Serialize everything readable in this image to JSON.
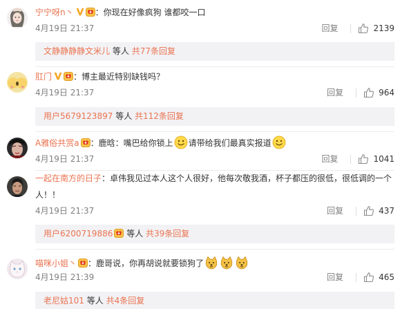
{
  "comments": [
    {
      "username": "宁宁呀n丶",
      "separator": "：",
      "text": "你现在好像疯狗 谁都咬一口",
      "time": "4月19日 21:37",
      "reply_label": "回复",
      "likes": "2139",
      "sub": {
        "user": "文静静静静文米儿",
        "etc": "等人",
        "total": "共77条回复"
      }
    },
    {
      "username": "肛门",
      "separator": "：",
      "text": "博主最近特别缺钱吗？",
      "time": "4月19日 21:37",
      "reply_label": "回复",
      "likes": "964",
      "sub": {
        "user": "用户5679123897",
        "etc": "等人",
        "total": "共112条回复"
      }
    },
    {
      "username": "A雅俗共赏a",
      "separator": "：",
      "text_a": "鹿晗：嘴巴给你锁上",
      "text_b": "请带给我们最真实报道",
      "time": "4月19日 21:37",
      "reply_label": "回复",
      "likes": "1041"
    },
    {
      "username": "一起在南方的日子",
      "separator": "：",
      "text": "卓伟我见过本人这个人很好，他每次敬我酒，杯子都压的很低，很低调的一个人！！",
      "time": "4月19日 21:37",
      "reply_label": "回复",
      "likes": "437",
      "sub": {
        "user": "用户6200719886",
        "etc": "等人",
        "total": "共39条回复"
      }
    },
    {
      "username": "喵咪小姐丶",
      "separator": "：",
      "text": "鹿哥说，你再胡说就要锁狗了",
      "time": "4月19日 21:39",
      "reply_label": "回复",
      "likes": "465",
      "sub": {
        "user": "老尼姑101",
        "etc": "等人",
        "total": "共4条回复"
      }
    }
  ],
  "colors": {
    "link": "#eb7350",
    "meta": "#808080",
    "subbox_bg": "#f2f2f5",
    "divider": "#eaeaec"
  },
  "icons": [
    "verified-v-icon",
    "member-badge-icon",
    "smile-emoji-icon",
    "doge-emoji-icon",
    "thumb-up-icon"
  ]
}
